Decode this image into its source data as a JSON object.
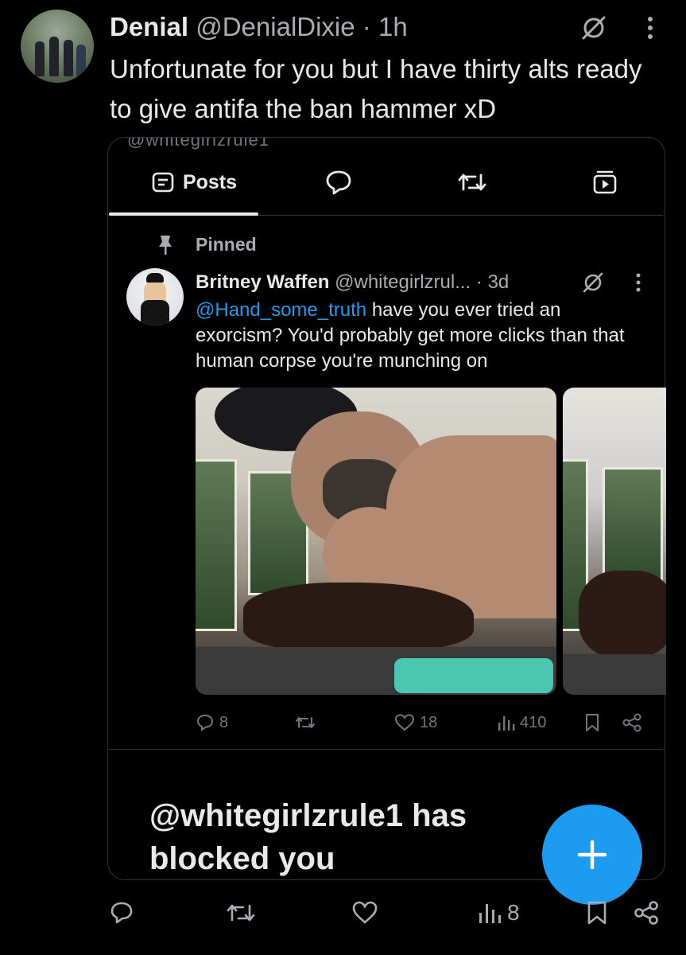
{
  "outer_tweet": {
    "name": "Denial",
    "handle": "@DenialDixie",
    "separator": "·",
    "time": "1h",
    "text": "Unfortunate for you but I have thirty alts ready to give antifa  the ban hammer xD"
  },
  "embedded_profile": {
    "cut_off_handle": "@whitegirlzrule1",
    "tabs": [
      {
        "label": "Posts",
        "icon": "posts-icon",
        "active": true
      },
      {
        "label": "",
        "icon": "reply-icon"
      },
      {
        "label": "",
        "icon": "repost-icon"
      },
      {
        "label": "",
        "icon": "media-icon"
      }
    ],
    "pinned_label": "Pinned",
    "pinned_post": {
      "name": "Britney Waffen",
      "handle": "@whitegirlzrul...",
      "separator": "·",
      "time": "3d",
      "mention": "@Hand_some_truth",
      "text": " have you ever tried an exorcism? You'd probably get more clicks than that human corpse you're munching on",
      "replies": "8",
      "reposts": "",
      "likes": "18",
      "views": "410"
    },
    "blocked_message": "@whitegirlzrule1 has blocked you"
  },
  "outer_actions": {
    "replies": "",
    "reposts": "",
    "likes": "",
    "views": "8"
  },
  "colors": {
    "background": "#000000",
    "accent": "#1d9bf0",
    "text": "#e7e9ea",
    "muted": "#71767b",
    "border": "#2f3336"
  }
}
